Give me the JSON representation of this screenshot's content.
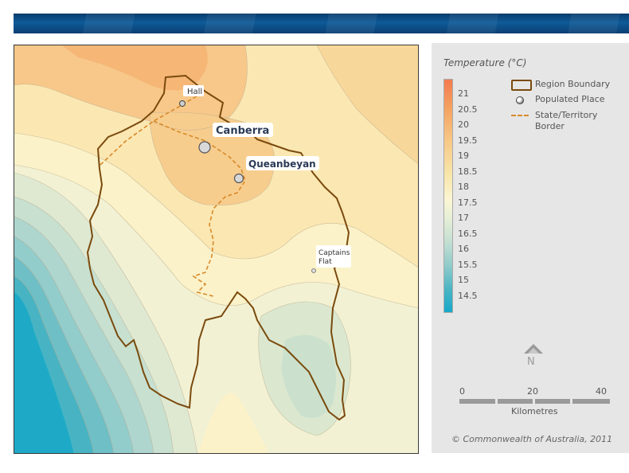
{
  "map": {
    "places": [
      {
        "name": "Hall"
      },
      {
        "name": "Canberra"
      },
      {
        "name": "Queanbeyan"
      },
      {
        "name": "Captains Flat"
      }
    ]
  },
  "legend": {
    "title": "Temperature (°C)",
    "ticks": [
      "21",
      "20.5",
      "20",
      "19.5",
      "19",
      "18.5",
      "18",
      "17.5",
      "17",
      "16.5",
      "16",
      "15.5",
      "15",
      "14.5"
    ],
    "items": {
      "boundary": "Region Boundary",
      "place": "Populated Place",
      "border_line1": "State/Territory",
      "border_line2": "Border"
    },
    "north": "N",
    "scale": {
      "labels": [
        "0",
        "20",
        "40"
      ],
      "units": "Kilometres"
    },
    "copyright": "© Commonwealth of Australia, 2011"
  },
  "colors": {
    "boundary": "#7a4a0d",
    "state_border": "#d88a2a",
    "temp_high": "#f47b4f",
    "temp_low": "#16a8c8"
  }
}
